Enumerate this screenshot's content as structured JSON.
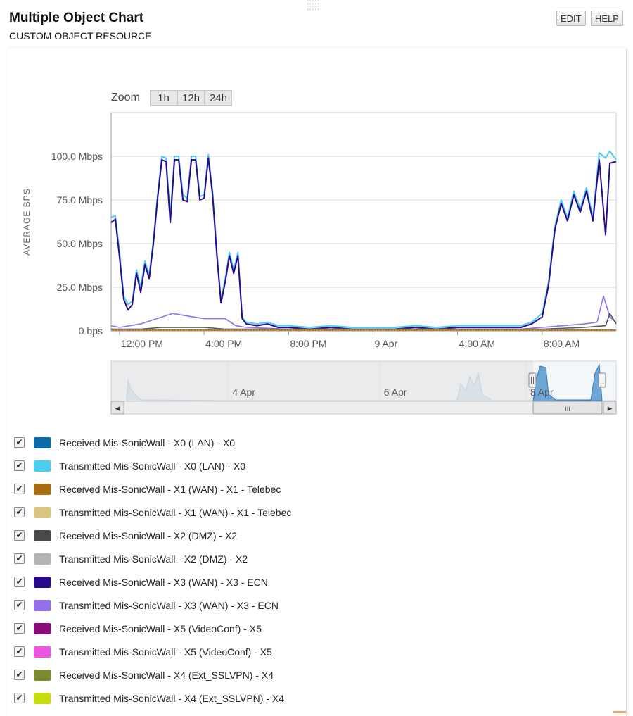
{
  "header": {
    "title": "Multiple Object Chart",
    "subtitle": "CUSTOM OBJECT RESOURCE",
    "edit_label": "EDIT",
    "help_label": "HELP"
  },
  "zoom": {
    "label": "Zoom",
    "options": [
      "1h",
      "12h",
      "24h"
    ]
  },
  "chart_data": {
    "type": "line",
    "ylabel": "AVERAGE BPS",
    "y_unit": "Mbps",
    "ylim": [
      0,
      125
    ],
    "y_ticks": [
      {
        "value": 0,
        "label": "0 bps"
      },
      {
        "value": 25,
        "label": "25.0 Mbps"
      },
      {
        "value": 50,
        "label": "50.0 Mbps"
      },
      {
        "value": 75,
        "label": "75.0 Mbps"
      },
      {
        "value": 100,
        "label": "100.0 Mbps"
      }
    ],
    "x_ticks": [
      "12:00 PM",
      "4:00 PM",
      "8:00 PM",
      "9 Apr",
      "4:00 AM",
      "8:00 AM"
    ],
    "x_tick_hours": [
      12,
      16,
      20,
      24,
      28,
      32
    ],
    "xlim_hours": [
      11.6,
      35.5
    ],
    "grid": true,
    "series": [
      {
        "name": "Transmitted Mis-SonicWall - X0 (LAN) - X0",
        "color": "#4dcdf0",
        "x": [
          11.6,
          11.8,
          12,
          12.2,
          12.4,
          12.6,
          12.8,
          13,
          13.2,
          13.4,
          13.6,
          13.8,
          14,
          14.2,
          14.4,
          14.6,
          14.8,
          15,
          15.2,
          15.4,
          15.6,
          15.8,
          16,
          16.2,
          16.4,
          16.6,
          16.8,
          17,
          17.2,
          17.4,
          17.6,
          17.8,
          18,
          18.5,
          19,
          19.5,
          20,
          21,
          22,
          23,
          24,
          25,
          26,
          27,
          28,
          29,
          30,
          31,
          31.5,
          32,
          32.3,
          32.6,
          32.9,
          33.2,
          33.5,
          33.8,
          34.1,
          34.4,
          34.7,
          35,
          35.2,
          35.5
        ],
        "y": [
          65,
          66,
          45,
          20,
          15,
          17,
          35,
          25,
          40,
          32,
          52,
          78,
          100,
          99,
          65,
          100,
          100,
          78,
          76,
          100,
          100,
          77,
          78,
          101,
          80,
          46,
          18,
          30,
          45,
          35,
          45,
          8,
          5,
          4,
          5,
          3,
          3,
          2,
          3,
          2,
          2,
          2,
          3,
          2,
          3,
          3,
          3,
          3,
          5,
          10,
          28,
          60,
          75,
          65,
          80,
          70,
          82,
          65,
          102,
          99,
          103,
          98
        ]
      },
      {
        "name": "Received Mis-SonicWall - X3 (WAN) - X3 - ECN",
        "color": "#2a0a8c",
        "x": [
          11.6,
          11.8,
          12,
          12.2,
          12.4,
          12.6,
          12.8,
          13,
          13.2,
          13.4,
          13.6,
          13.8,
          14,
          14.2,
          14.4,
          14.6,
          14.8,
          15,
          15.2,
          15.4,
          15.6,
          15.8,
          16,
          16.2,
          16.4,
          16.6,
          16.8,
          17,
          17.2,
          17.4,
          17.6,
          17.8,
          18,
          18.5,
          19,
          19.5,
          20,
          21,
          22,
          23,
          24,
          25,
          26,
          27,
          28,
          29,
          30,
          31,
          31.5,
          32,
          32.3,
          32.6,
          32.9,
          33.2,
          33.5,
          33.8,
          34.1,
          34.4,
          34.7,
          35,
          35.2,
          35.5
        ],
        "y": [
          62,
          64,
          42,
          18,
          12,
          15,
          33,
          22,
          38,
          30,
          50,
          76,
          98,
          97,
          62,
          98,
          98,
          75,
          74,
          98,
          98,
          75,
          76,
          99,
          78,
          44,
          16,
          28,
          43,
          33,
          43,
          7,
          4,
          3,
          4,
          2,
          2,
          1,
          2,
          1,
          1,
          1,
          2,
          1,
          2,
          2,
          2,
          2,
          4,
          8,
          26,
          58,
          73,
          63,
          78,
          68,
          80,
          63,
          98,
          55,
          96,
          97
        ]
      },
      {
        "name": "Transmitted Mis-SonicWall - X3 (WAN) - X3 - ECN",
        "color": "#9370e8",
        "x": [
          11.6,
          12,
          12.5,
          13,
          13.5,
          14,
          14.5,
          15,
          15.5,
          16,
          16.5,
          17,
          17.5,
          18,
          20,
          24,
          28,
          31,
          32,
          33,
          34,
          34.6,
          34.9,
          35.2,
          35.5
        ],
        "y": [
          3,
          2,
          3,
          4,
          6,
          8,
          10,
          9,
          8,
          7,
          7,
          7,
          3,
          2,
          1,
          1,
          1,
          1,
          2,
          3,
          4,
          5,
          20,
          8,
          5
        ]
      },
      {
        "name": "Received Mis-SonicWall - X2 (DMZ) - X2",
        "color": "#555555",
        "x": [
          11.6,
          13,
          14,
          15,
          16,
          17,
          18,
          20,
          24,
          28,
          32,
          34,
          35,
          35.2,
          35.5
        ],
        "y": [
          1,
          1,
          2,
          2,
          2,
          1,
          1,
          1,
          1,
          1,
          1,
          2,
          3,
          10,
          4
        ]
      },
      {
        "name": "Received Mis-SonicWall - X1 (WAN) - X1 - Telebec",
        "color": "#a86c10",
        "x": [
          11.6,
          35.5
        ],
        "y": [
          0.5,
          0.5
        ]
      }
    ]
  },
  "navigator": {
    "date_labels": [
      "4 Apr",
      "6 Apr",
      "8 Apr"
    ],
    "date_positions": [
      0.24,
      0.54,
      0.83
    ],
    "handle_glyph": "III",
    "left_arrow": "◂",
    "right_arrow": "▸"
  },
  "legend": [
    {
      "label": "Received Mis-SonicWall - X0 (LAN) - X0",
      "color": "#0b6aa8",
      "checked": true
    },
    {
      "label": "Transmitted Mis-SonicWall - X0 (LAN) - X0",
      "color": "#4dcdf0",
      "checked": true
    },
    {
      "label": "Received Mis-SonicWall - X1 (WAN) - X1 - Telebec",
      "color": "#a86c10",
      "checked": true
    },
    {
      "label": "Transmitted Mis-SonicWall - X1 (WAN) - X1 - Telebec",
      "color": "#d9c483",
      "checked": true
    },
    {
      "label": "Received Mis-SonicWall - X2 (DMZ) - X2",
      "color": "#4a4a4a",
      "checked": true
    },
    {
      "label": "Transmitted Mis-SonicWall - X2 (DMZ) - X2",
      "color": "#b4b4b4",
      "checked": true
    },
    {
      "label": "Received Mis-SonicWall - X3 (WAN) - X3 - ECN",
      "color": "#2a0a8c",
      "checked": true
    },
    {
      "label": "Transmitted Mis-SonicWall - X3 (WAN) - X3 - ECN",
      "color": "#9370e8",
      "checked": true
    },
    {
      "label": "Received Mis-SonicWall - X5 (VideoConf) - X5",
      "color": "#8a0a7c",
      "checked": true
    },
    {
      "label": "Transmitted Mis-SonicWall - X5 (VideoConf) - X5",
      "color": "#ee55e0",
      "checked": true
    },
    {
      "label": "Received Mis-SonicWall - X4 (Ext_SSLVPN) - X4",
      "color": "#7a8a30",
      "checked": true
    },
    {
      "label": "Transmitted Mis-SonicWall - X4 (Ext_SSLVPN) - X4",
      "color": "#c8dd10",
      "checked": true
    }
  ],
  "checkbox_glyph": "✔"
}
